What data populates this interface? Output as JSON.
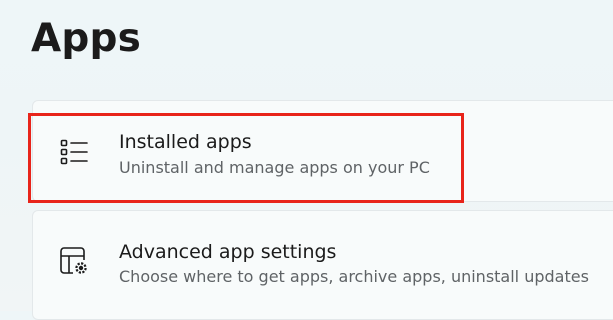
{
  "page": {
    "title": "Apps"
  },
  "settings_items": [
    {
      "title": "Installed apps",
      "subtitle": "Uninstall and manage apps on your PC",
      "icon": "list-icon",
      "highlighted": true
    },
    {
      "title": "Advanced app settings",
      "subtitle": "Choose where to get apps, archive apps, uninstall updates",
      "icon": "app-settings-gear-icon",
      "highlighted": false
    }
  ],
  "colors": {
    "highlight": "#e8241a",
    "background": "#eef6f8",
    "card": "#f8fbfb",
    "subtitle_text": "#5f6366"
  }
}
